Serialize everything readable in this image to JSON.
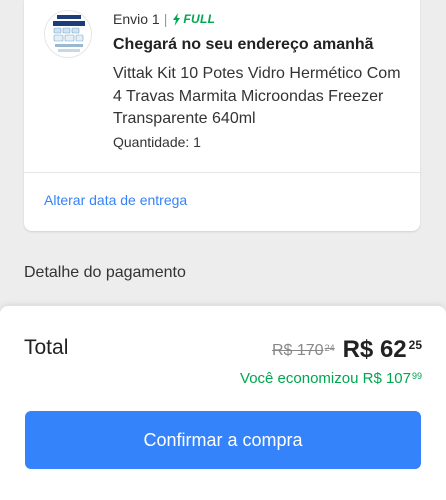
{
  "shipment": {
    "label": "Envio 1",
    "separator": "|",
    "badge_text": "FULL",
    "badge_color": "#00a650",
    "arrival": "Chegará no seu endereço amanhã",
    "product_title": "Vittak Kit 10 Potes Vidro Hermético Com 4 Travas Marmita Microondas Freezer Transparente 640ml",
    "quantity": "Quantidade: 1",
    "thumbnail_icon": "product-thumbnail",
    "change_date_link": "Alterar data de entrega"
  },
  "payment": {
    "section_title": "Detalhe do pagamento"
  },
  "summary": {
    "total_label": "Total",
    "old_price_main": "R$ 170",
    "old_price_cents": "24",
    "new_price_main": "R$ 62",
    "new_price_cents": "25",
    "savings_main": "Você economizou R$ 107",
    "savings_cents": "99",
    "confirm_button": "Confirmar a compra",
    "accent_color": "#3483fa"
  }
}
